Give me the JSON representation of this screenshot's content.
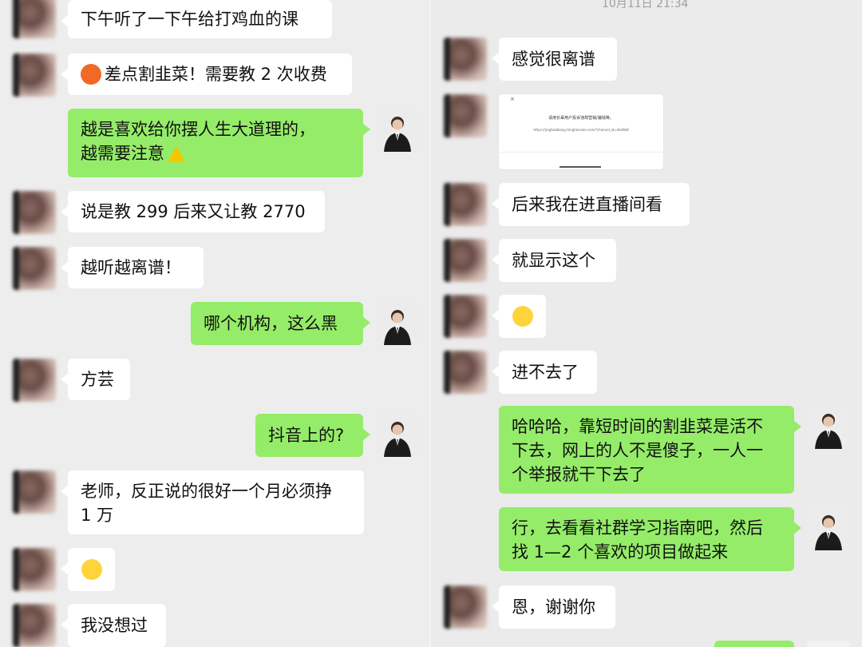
{
  "left": {
    "messages": [
      {
        "text": "下午听了一下午给打鸡血的课"
      },
      {
        "text": "差点割韭菜！需要教 2 次收费",
        "emoji": "angry-face-icon"
      },
      {
        "line1": "越是喜欢给你摆人生大道理的，",
        "line2": "越需要注意",
        "emoji": "warning-icon"
      },
      {
        "text": "说是教 299 后来又让教 2770"
      },
      {
        "text": "越听越离谱！"
      },
      {
        "text": "哪个机构，这么黑"
      },
      {
        "text": "方芸"
      },
      {
        "text": "抖音上的?"
      },
      {
        "line1": "老师，反正说的很好一个月必须挣",
        "line2": "1 万"
      },
      {
        "emoji": "thinking-face-icon"
      },
      {
        "text": "我没想过"
      }
    ]
  },
  "right": {
    "timestamp": "10月11日 21:34",
    "screenshot": {
      "title": "请用长辈用户投诉违规营销/骗钱等。",
      "url": "https://jingtaobbcay.mingliansole.com/?channel_id=4ke6b8",
      "close": "×"
    },
    "messages": [
      {
        "text": "感觉很离谱"
      },
      {
        "text": "后来我在进直播间看"
      },
      {
        "text": "就显示这个"
      },
      {
        "emoji": "thinking-face-icon"
      },
      {
        "text": "进不去了"
      },
      {
        "line1": "哈哈哈，靠短时间的割韭菜是活不",
        "line2": "下去，网上的人不是傻子，一人一",
        "line3": "个举报就干下去了"
      },
      {
        "line1": "行，去看看社群学习指南吧，然后",
        "line2": "找 1—2 个喜欢的项目做起来"
      },
      {
        "text": "恩，谢谢你"
      }
    ]
  },
  "colors": {
    "background": "#ededed",
    "sent_bubble": "#95ec69",
    "received_bubble": "#ffffff",
    "timestamp": "#9e9e9e"
  }
}
